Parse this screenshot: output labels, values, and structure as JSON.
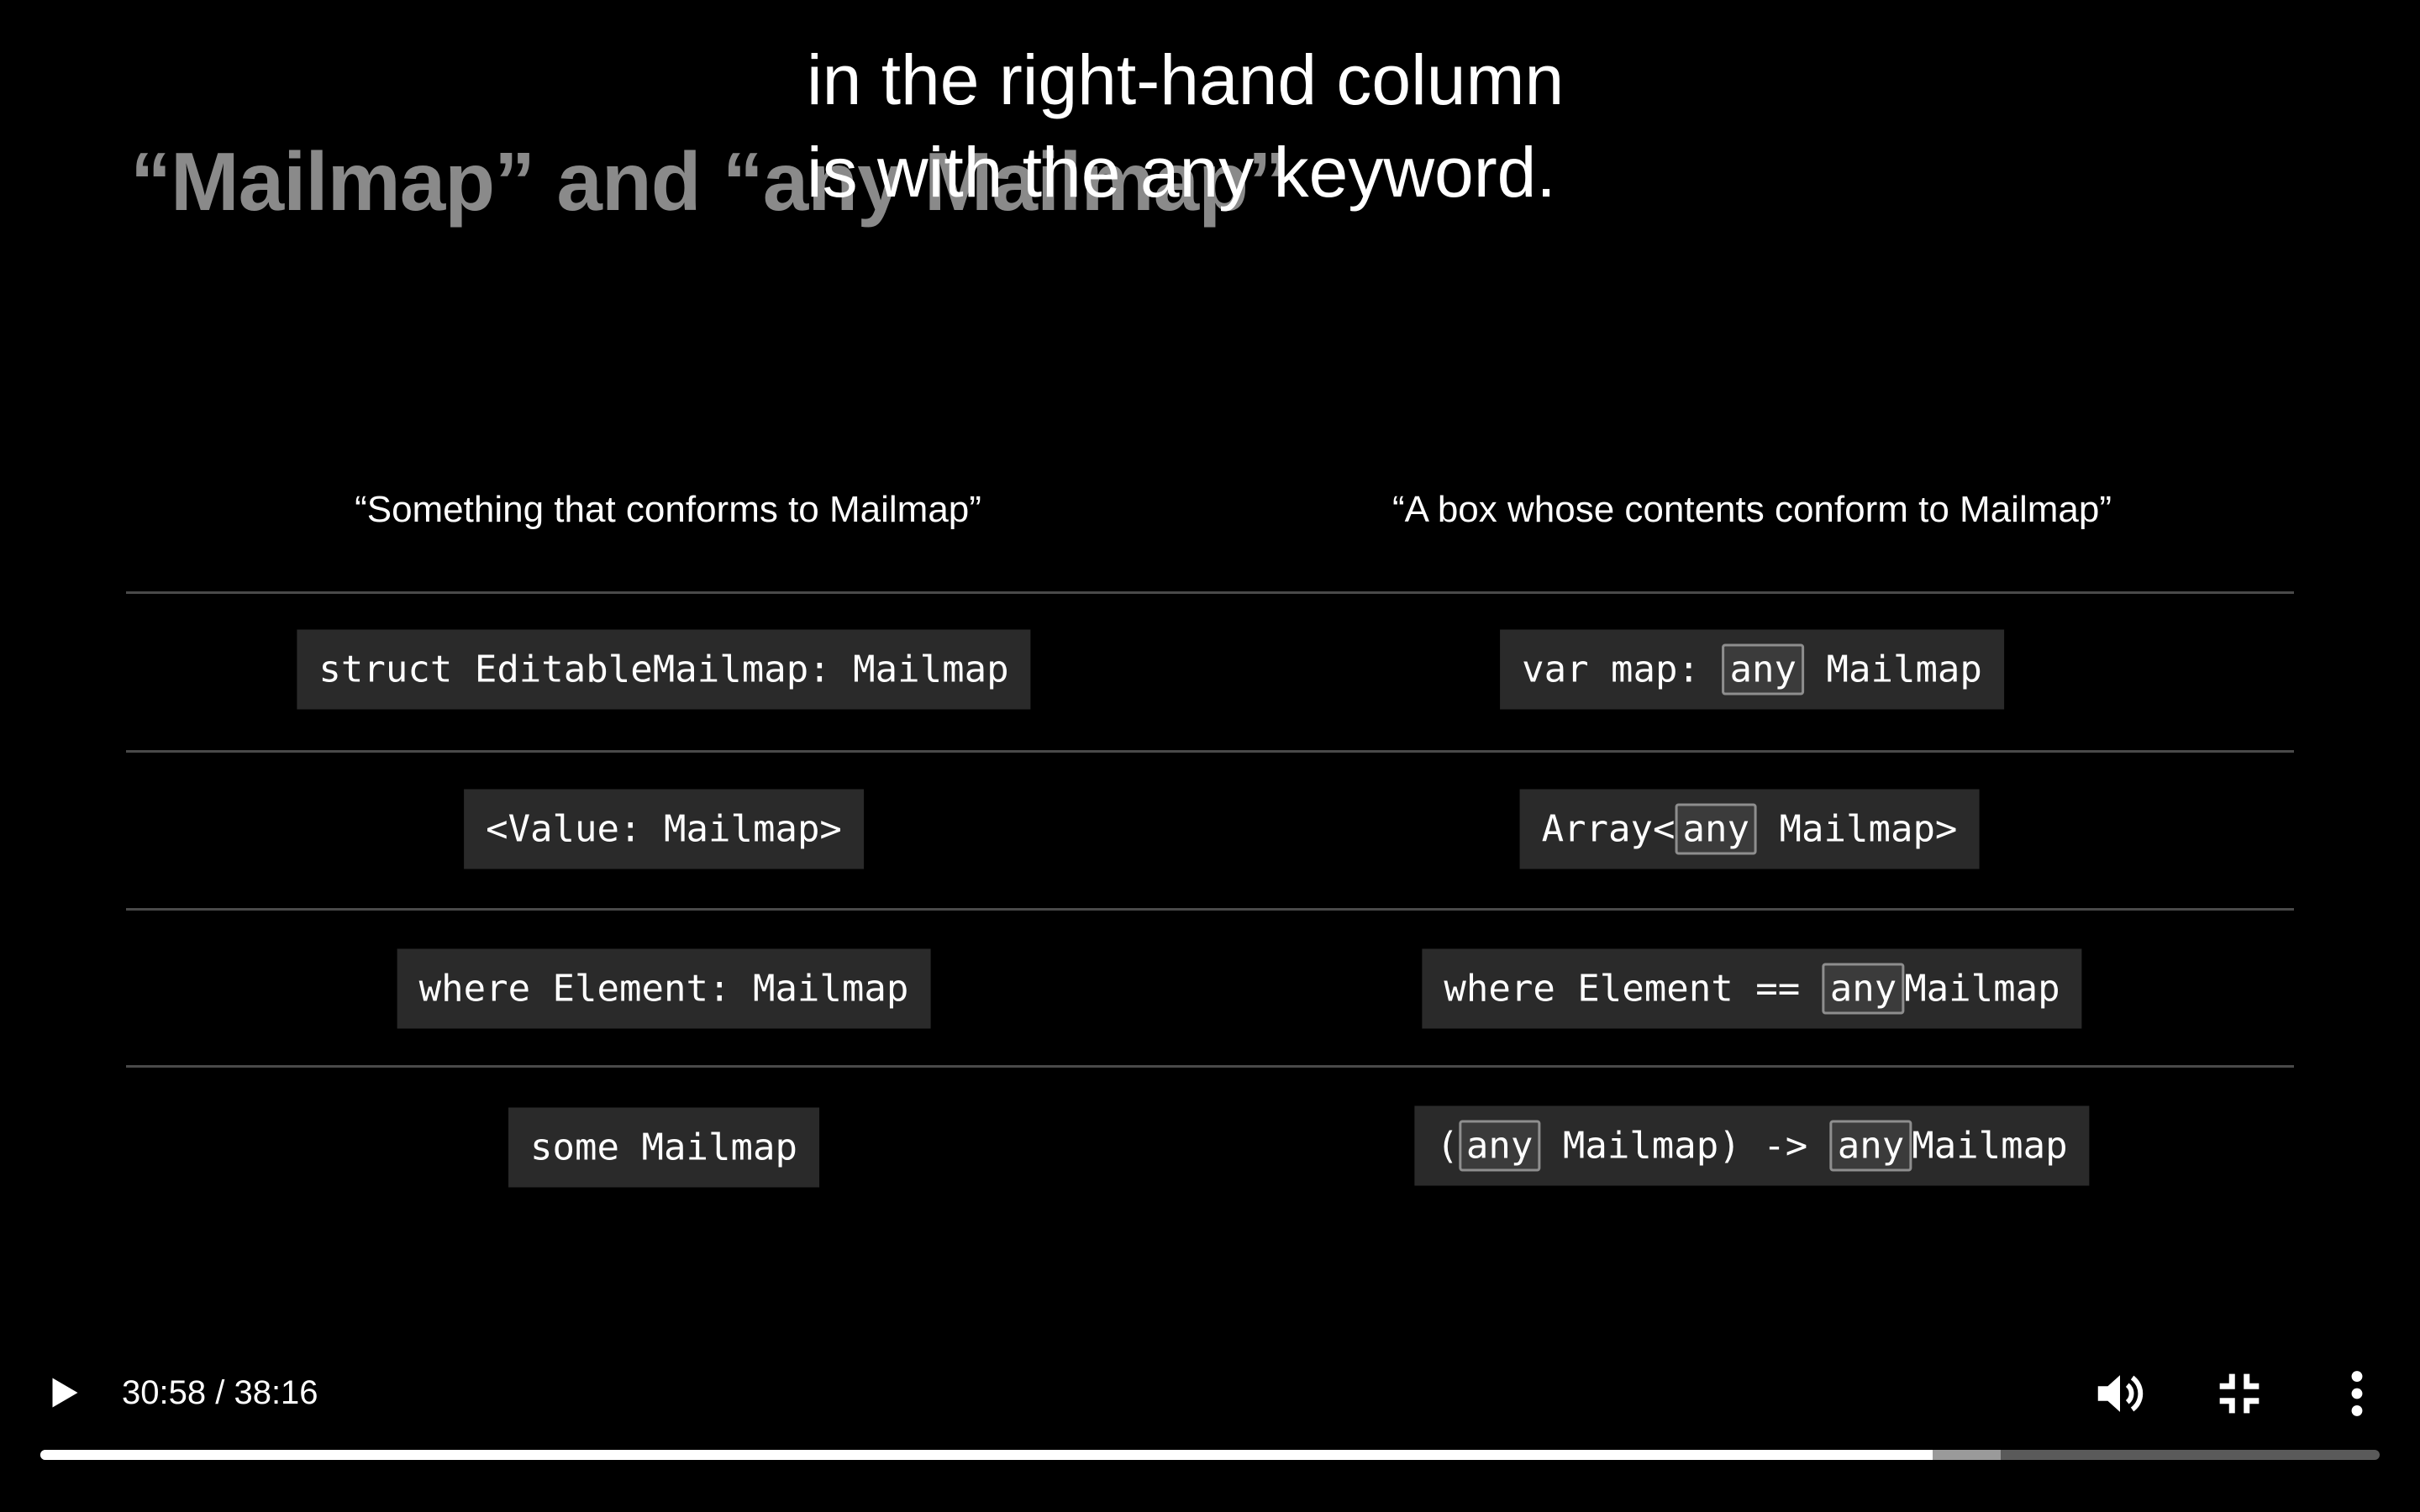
{
  "slide": {
    "title_left": "“Mailmap” and “",
    "title_right": "any Mailmap”"
  },
  "caption": {
    "line1": "in the right-hand column",
    "line2": "is with the any keyword."
  },
  "columns": {
    "left_header": "“Something that conforms to Mailmap”",
    "right_header": "“A box whose contents conform to Mailmap”"
  },
  "rows": [
    {
      "left": "struct EditableMailmap: Mailmap",
      "right": {
        "a": "var map: ",
        "kw1": "any",
        "b": " Mailmap"
      }
    },
    {
      "left": "<Value: Mailmap>",
      "right": {
        "a": "Array<",
        "kw1": "any",
        "b": " Mailmap>"
      }
    },
    {
      "left": "where Element: Mailmap",
      "right": {
        "a": "where Element == ",
        "kw1": "any",
        "b": "Mailmap"
      }
    },
    {
      "left": "some Mailmap",
      "right": {
        "a": "(",
        "kw1": "any",
        "b": " Mailmap) -> ",
        "kw2": "any",
        "c": "Mailmap"
      }
    }
  ],
  "player": {
    "current_time": "30:58",
    "duration": "38:16",
    "time_separator": " / ",
    "progress_fraction": 0.809,
    "buffered_fraction": 0.838,
    "icons": [
      "play-icon",
      "volume-icon",
      "exit-fullscreen-icon",
      "more-vert-icon"
    ]
  }
}
